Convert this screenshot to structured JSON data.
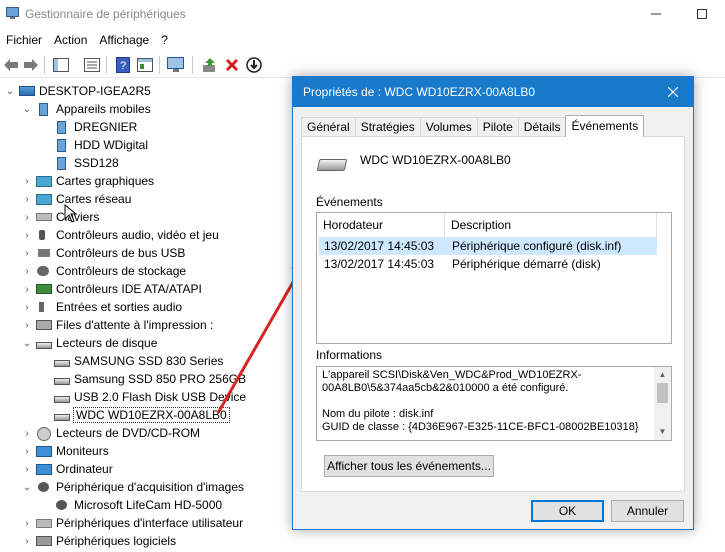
{
  "window": {
    "title": "Gestionnaire de périphériques"
  },
  "menu": [
    "Fichier",
    "Action",
    "Affichage",
    "?"
  ],
  "tree": {
    "root": "DESKTOP-IGEA2R5",
    "items": [
      "Appareils mobiles",
      "DREGNIER",
      "HDD WDigital",
      "SSD128",
      "Cartes graphiques",
      "Cartes réseau",
      "Claviers",
      "Contrôleurs audio, vidéo et jeu",
      "Contrôleurs de bus USB",
      "Contrôleurs de stockage",
      "Contrôleurs IDE ATA/ATAPI",
      "Entrées et sorties audio",
      "Files d'attente à l'impression :",
      "Lecteurs de disque",
      "SAMSUNG SSD 830 Series",
      "Samsung SSD 850 PRO 256GB",
      "USB 2.0 Flash Disk USB Device",
      "WDC WD10EZRX-00A8LB0",
      "Lecteurs de DVD/CD-ROM",
      "Moniteurs",
      "Ordinateur",
      "Périphérique d'acquisition d'images",
      "Microsoft LifeCam HD-5000",
      "Périphériques d'interface utilisateur",
      "Périphériques logiciels"
    ]
  },
  "dialog": {
    "title": "Propriétés de : WDC WD10EZRX-00A8LB0",
    "tabs": [
      "Général",
      "Stratégies",
      "Volumes",
      "Pilote",
      "Détails",
      "Événements"
    ],
    "active_tab": "Événements",
    "device_name": "WDC WD10EZRX-00A8LB0",
    "events_label": "Événements",
    "columns": [
      "Horodateur",
      "Description"
    ],
    "events": [
      {
        "timestamp": "13/02/2017 14:45:03",
        "description": "Périphérique configuré (disk.inf)"
      },
      {
        "timestamp": "13/02/2017 14:45:03",
        "description": "Périphérique démarré (disk)"
      }
    ],
    "info_label": "Informations",
    "info_lines": [
      "L'appareil SCSI\\Disk&Ven_WDC&Prod_WD10EZRX-",
      "00A8LB0\\5&374aa5cb&2&010000 a été configuré.",
      "",
      "Nom du pilote : disk.inf",
      "GUID de classe : {4D36E967-E325-11CE-BFC1-08002BE10318}"
    ],
    "show_all_label": "Afficher tous les événements...",
    "ok_label": "OK",
    "cancel_label": "Annuler"
  }
}
